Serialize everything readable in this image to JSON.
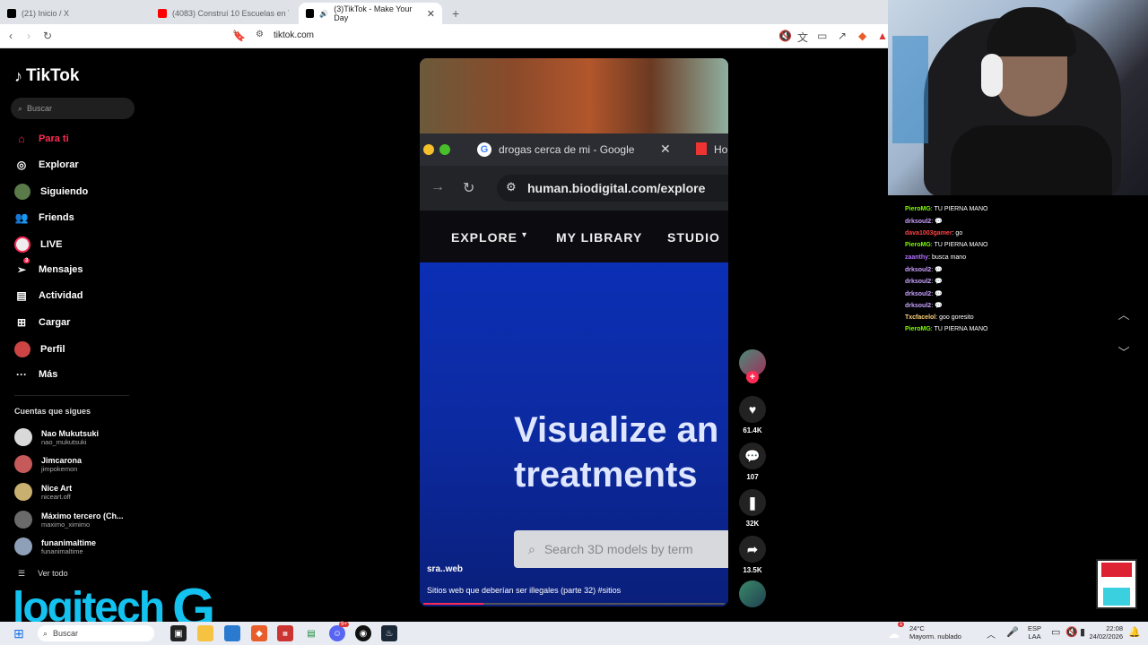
{
  "browser": {
    "tabs": [
      {
        "label": "(21) Inicio / X",
        "color": "#000000"
      },
      {
        "label": "(4083) Construí 10 Escuelas en Todo",
        "color": "#ff0000"
      },
      {
        "label": "(3)TikTok - Make Your Day",
        "color": "#000000"
      }
    ],
    "url": "tiktok.com"
  },
  "tiktok": {
    "logo": "TikTok",
    "search_placeholder": "Buscar",
    "nav": [
      {
        "label": "Para ti"
      },
      {
        "label": "Explorar"
      },
      {
        "label": "Siguiendo"
      },
      {
        "label": "Friends"
      },
      {
        "label": "LIVE"
      },
      {
        "label": "Mensajes",
        "badge": "3"
      },
      {
        "label": "Actividad"
      },
      {
        "label": "Cargar"
      },
      {
        "label": "Perfil"
      },
      {
        "label": "Más"
      }
    ],
    "following_title": "Cuentas que sigues",
    "following": [
      {
        "name": "Nao Mukutsuki",
        "handle": "nao_mukutsuki",
        "color": "#d9d9d9"
      },
      {
        "name": "Jimcarona",
        "handle": "jimpokemon",
        "color": "#c65a5a"
      },
      {
        "name": "Nice Art",
        "handle": "niceart.off",
        "color": "#c8b070"
      },
      {
        "name": "Máximo tercero (Ch...",
        "handle": "maximo_ximimo",
        "color": "#6a6a6a"
      },
      {
        "name": "funanimaltime",
        "handle": "funanimaltime",
        "color": "#8ea0b8"
      }
    ],
    "see_all": "Ver todo",
    "overlay_brand": "logitech",
    "overlay_brand_g": "G"
  },
  "video": {
    "inner_tab": "drogas cerca de mi - Google",
    "inner_tab_next": "Ho",
    "inner_url": "human.biodigital.com/explore",
    "inner_menu": [
      "EXPLORE",
      "MY LIBRARY",
      "STUDIO"
    ],
    "headline_1": "Visualize an",
    "headline_2": "treatments",
    "search_placeholder": "Search 3D models by term",
    "author": "sra..web",
    "caption": "Sitios web que deberían ser illegales (parte 32) #sitios",
    "progress": 0.2
  },
  "actions": {
    "likes": "61.4K",
    "comments": "107",
    "saves": "32K",
    "shares": "13.5K"
  },
  "chat": [
    {
      "user": "PieroMG",
      "text": ": TU PIERNA MANO",
      "color": "#7cfc00"
    },
    {
      "user": "drksoul2",
      "text": ": 💬",
      "color": "#c8a0ff"
    },
    {
      "user": "dava1003gamer",
      "text": ": go",
      "color": "#ff4444"
    },
    {
      "user": "PieroMG",
      "text": ": TU PIERNA MANO",
      "color": "#7cfc00"
    },
    {
      "user": "zaanthy",
      "text": ": busca mano",
      "color": "#b070ff"
    },
    {
      "user": "drksoul2",
      "text": ": 💬",
      "color": "#c8a0ff"
    },
    {
      "user": "drksoul2",
      "text": ": 💬",
      "color": "#c8a0ff"
    },
    {
      "user": "drksoul2",
      "text": ": 💬",
      "color": "#c8a0ff"
    },
    {
      "user": "drksoul2",
      "text": ": 💬",
      "color": "#c8a0ff"
    },
    {
      "user": "Txcfacelol",
      "text": ": goo goresito",
      "color": "#ffd27a"
    },
    {
      "user": "PieroMG",
      "text": ": TU PIERNA MANO",
      "color": "#7cfc00"
    }
  ],
  "taskbar": {
    "search": "Buscar",
    "weather_temp": "24°C",
    "weather_desc": "Mayorm. nublado",
    "lang_1": "ESP",
    "lang_2": "LAA",
    "time": "22:08",
    "date": "24/02/2026",
    "discord_badge": "9+",
    "weather_badge": "1"
  }
}
